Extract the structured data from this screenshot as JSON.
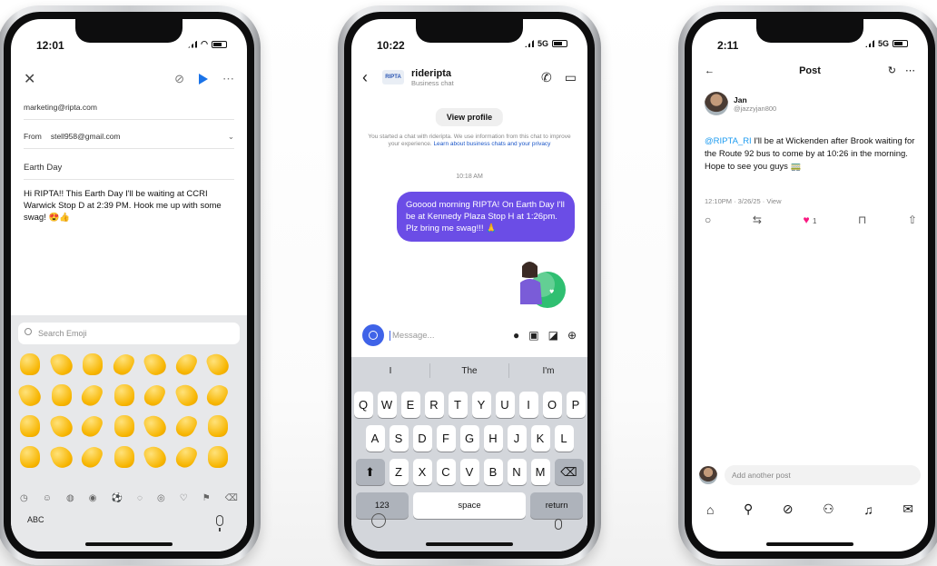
{
  "phone1": {
    "status_time": "12:01",
    "to": "marketing@ripta.com",
    "from_label": "From",
    "from_value": "stell958@gmail.com",
    "subject": "Earth Day",
    "body": "Hi RIPTA!! This Earth Day I'll be waiting at CCRI Warwick Stop D at 2:39 PM. Hook me up with some swag! 😍👍",
    "emoji_search_placeholder": "Search Emoji",
    "abc_label": "ABC"
  },
  "phone2": {
    "status_time": "10:22",
    "status_net": "5G",
    "chat_name": "rideripta",
    "chat_subtitle": "Business chat",
    "logo_text": "RIPTA",
    "view_profile": "View profile",
    "disclaimer": "You started a chat with rideripta. We use information from this chat to improve your experience.",
    "disclaimer_link": "Learn about business chats and your privacy",
    "timestamp": "10:18 AM",
    "message": "Gooood morning RIPTA! On Earth Day I'll be at Kennedy Plaza Stop H at 1:26pm. Plz bring me swag!!! 🙏",
    "message_placeholder": "Message...",
    "suggestions": [
      "I",
      "The",
      "I'm"
    ],
    "keyboard_rows": [
      [
        "Q",
        "W",
        "E",
        "R",
        "T",
        "Y",
        "U",
        "I",
        "O",
        "P"
      ],
      [
        "A",
        "S",
        "D",
        "F",
        "G",
        "H",
        "J",
        "K",
        "L"
      ],
      [
        "Z",
        "X",
        "C",
        "V",
        "B",
        "N",
        "M"
      ]
    ],
    "key_123": "123",
    "key_space": "space",
    "key_return": "return"
  },
  "phone3": {
    "status_time": "2:11",
    "status_net": "5G",
    "post_title": "Post",
    "author_name": "Jan",
    "author_handle": "@jazzyjan800",
    "post_mention": "@RIPTA_RI",
    "post_text": " I'll be at Wickenden after Brook waiting for the Route 92 bus to come by at 10:26 in the morning. Hope to see you guys 🚃",
    "post_meta": "12:10PM · 3/26/25 · View",
    "like_count": "1",
    "reply_placeholder": "Add another post"
  },
  "colors": {
    "ripta_purple": "#6b4de6",
    "instagram_blue": "#3f63e8",
    "x_mention_blue": "#1d9bf0",
    "like_pink": "#f91880"
  }
}
